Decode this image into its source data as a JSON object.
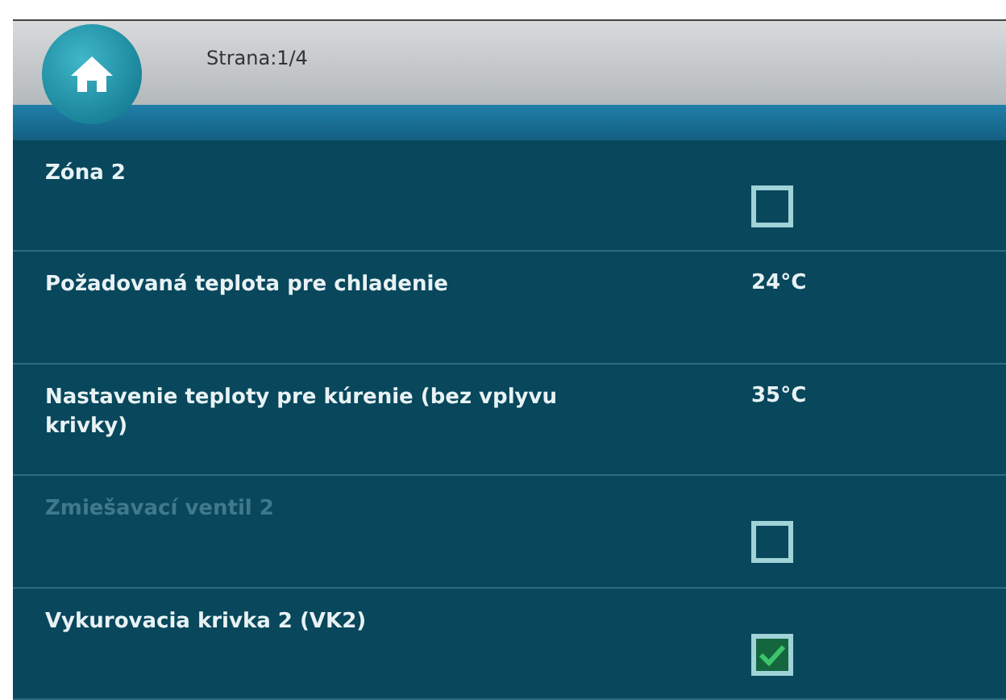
{
  "header": {
    "page_label": "Strana:1/4"
  },
  "rows": [
    {
      "kind": "checkbox",
      "label": "Zóna 2",
      "checked": false,
      "disabled": false
    },
    {
      "kind": "value",
      "label": "Požadovaná teplota pre chladenie",
      "value": "24°C"
    },
    {
      "kind": "value",
      "label": "Nastavenie teploty pre kúrenie (bez vplyvu krivky)",
      "value": "35°C"
    },
    {
      "kind": "checkbox",
      "label": "Zmiešavací ventil 2",
      "checked": false,
      "disabled": true
    },
    {
      "kind": "checkbox",
      "label": "Vykurovacia krivka 2 (VK2)",
      "checked": true,
      "disabled": false
    }
  ]
}
